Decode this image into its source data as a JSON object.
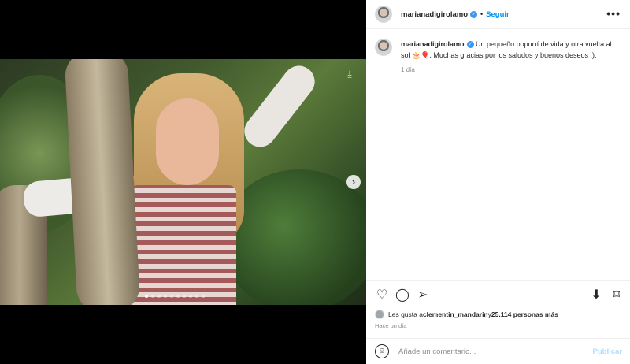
{
  "post": {
    "username": "marianadigirolamo",
    "follow_label": "Seguir",
    "separator": "•",
    "more_label": "•••",
    "caption_text": " Un pequeño popurrí de vida y otra vuelta al sol 🎂🎈. Muchas gracias por los saludos y buenos deseos :).",
    "caption_time": "1 día",
    "likes_prefix": "Les gusta a ",
    "likes_user": "clementin_mandarin",
    "likes_connector": " y ",
    "likes_count": "25.114 personas más",
    "post_time": "Hace un día"
  },
  "media": {
    "next_label": "›",
    "download_label": "⤓",
    "carousel_total": 10,
    "carousel_active": 1
  },
  "actions": {
    "like": "♡",
    "comment": "◯",
    "share": "➢",
    "save": "⬇",
    "bookmark": "⌑"
  },
  "comment_box": {
    "emoji": "☺",
    "placeholder": "Añade un comentario...",
    "publish_label": "Publicar"
  },
  "colors": {
    "accent": "#0095f6",
    "verified": "#3897f0",
    "muted": "#8e8e8e"
  }
}
